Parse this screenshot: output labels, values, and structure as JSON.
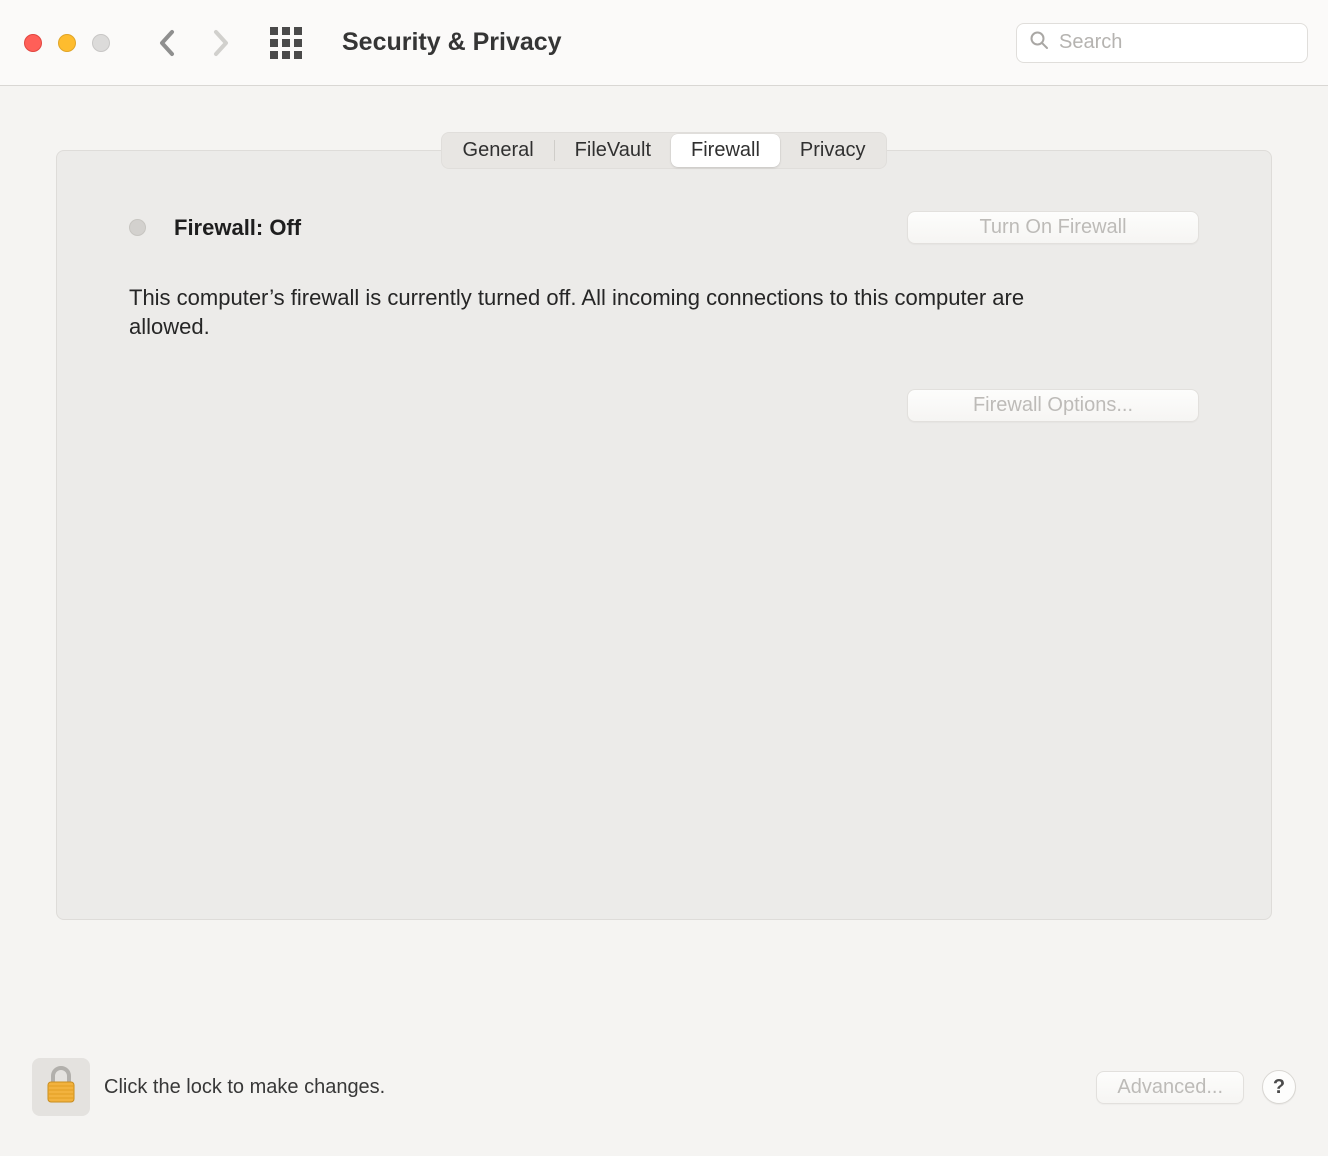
{
  "window": {
    "title": "Security & Privacy"
  },
  "search": {
    "placeholder": "Search",
    "value": ""
  },
  "tabs": {
    "general": "General",
    "filevault": "FileVault",
    "firewall": "Firewall",
    "privacy": "Privacy",
    "active": "firewall"
  },
  "firewall": {
    "status_label": "Firewall: Off",
    "turn_on_button": "Turn On Firewall",
    "description": "This computer’s firewall is currently turned off. All incoming connections to this computer are allowed.",
    "options_button": "Firewall Options..."
  },
  "footer": {
    "lock_label": "Click the lock to make changes.",
    "advanced_button": "Advanced...",
    "help_label": "?"
  }
}
